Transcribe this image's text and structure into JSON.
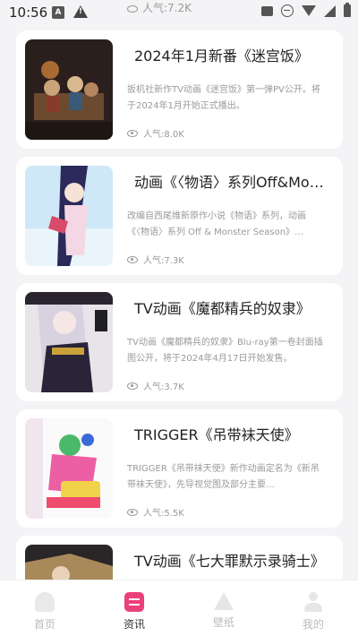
{
  "status_bar": {
    "time": "10:56",
    "a_badge": "A",
    "warn_badge": "!"
  },
  "partial_item": {
    "popularity": "人气:7.2K"
  },
  "articles": [
    {
      "title": "2024年1月新番《迷宫饭》",
      "summary": "扳机社新作TV动画《迷宫饭》第一弹PV公开。将于2024年1月开始正式播出。",
      "popularity": "人气:8.0K"
    },
    {
      "title": "动画《〈物语〉系列Off&Monster Season》",
      "summary": "改编自西尾维新原作小说《物语》系列，动画《〈物语〉系列 Off & Monster Season》…",
      "popularity": "人气:7.3K"
    },
    {
      "title": "TV动画《魔都精兵的奴隶》",
      "summary": "TV动画《魔都精兵的奴隶》Blu-ray第一卷封面插图公开，将于2024年4月17日开始发售。",
      "popularity": "人气:3.7K"
    },
    {
      "title": "TRIGGER《吊带袜天使》",
      "summary": "TRIGGER《吊带袜天使》新作动画定名为《新吊带袜天使》，先导视觉图及部分主要…",
      "popularity": "人气:5.5K"
    },
    {
      "title": "TV动画《七大罪默示录骑士》",
      "summary": "",
      "popularity": ""
    }
  ],
  "nav": [
    {
      "label": "首页"
    },
    {
      "label": "资讯"
    },
    {
      "label": "壁纸"
    },
    {
      "label": "我的"
    }
  ],
  "colors": {
    "accent": "#ec407a",
    "background": "#f4f4f6"
  }
}
